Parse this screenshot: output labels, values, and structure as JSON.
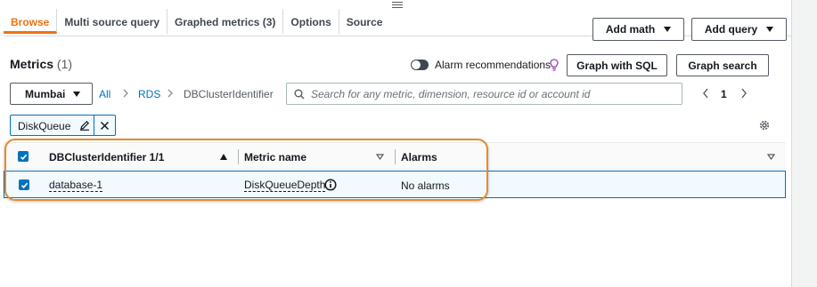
{
  "tabs": [
    {
      "label": "Browse",
      "active": true
    },
    {
      "label": "Multi source query",
      "active": false
    },
    {
      "label": "Graphed metrics (3)",
      "active": false
    },
    {
      "label": "Options",
      "active": false
    },
    {
      "label": "Source",
      "active": false
    }
  ],
  "toolbar": {
    "add_math_label": "Add math",
    "add_query_label": "Add query",
    "graph_sql_label": "Graph with SQL",
    "graph_search_label": "Graph search"
  },
  "metrics": {
    "title": "Metrics",
    "count": "(1)",
    "alarm_recommendations_label": "Alarm recommendations",
    "alarm_recommendations_on": false
  },
  "filter": {
    "region": "Mumbai",
    "breadcrumb": [
      "All",
      "RDS",
      "DBClusterIdentifier"
    ],
    "search_placeholder": "Search for any metric, dimension, resource id or account id",
    "search_value": "",
    "page": "1",
    "token_label": "DiskQueue"
  },
  "table": {
    "columns": [
      "DBClusterIdentifier 1/1",
      "Metric name",
      "Alarms"
    ],
    "rows": [
      {
        "checked": true,
        "identifier": "database-1",
        "metric": "DiskQueueDepth",
        "alarms": "No alarms"
      }
    ]
  },
  "colors": {
    "accent": "#ec7211",
    "link": "#0073bb",
    "highlight": "#e98a2a"
  }
}
